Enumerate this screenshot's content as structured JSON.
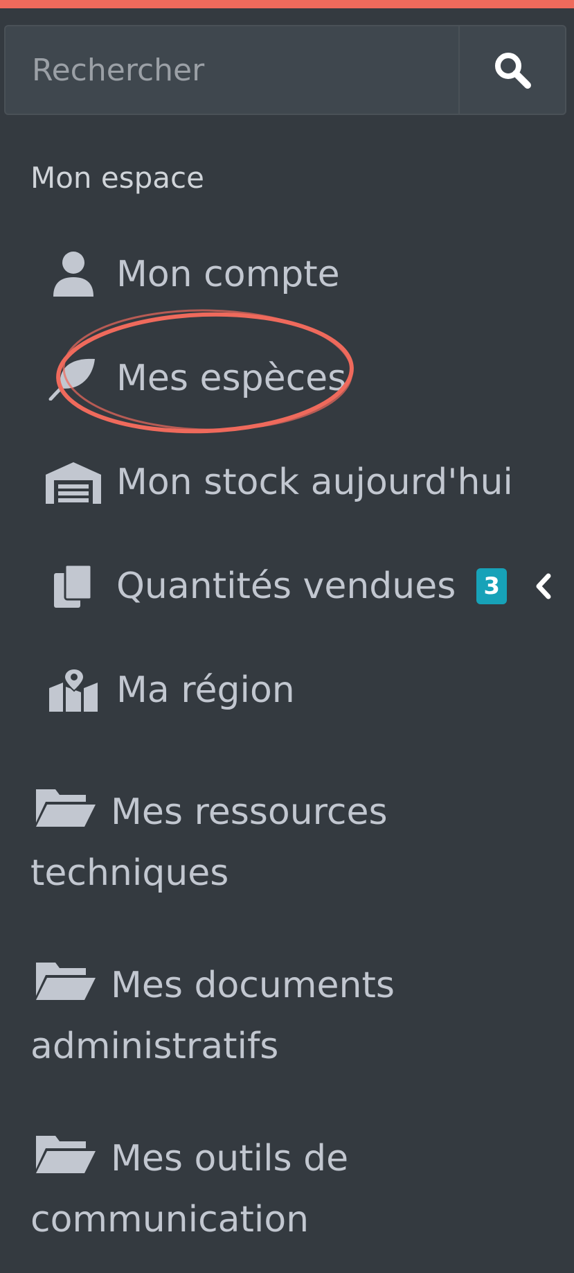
{
  "search": {
    "placeholder": "Rechercher",
    "button_icon": "search-icon"
  },
  "section": {
    "title": "Mon espace"
  },
  "nav": {
    "items": [
      {
        "label": "Mon compte",
        "icon": "user-icon"
      },
      {
        "label": "Mes espèces",
        "icon": "leaf-icon"
      },
      {
        "label": "Mon stock aujourd'hui",
        "icon": "warehouse-icon"
      },
      {
        "label": "Quantités vendues",
        "icon": "copy-icon",
        "badge": "3",
        "expand_icon": "chevron-left-icon"
      },
      {
        "label": "Ma région",
        "icon": "map-marked-icon"
      }
    ],
    "folders": [
      {
        "label": "Mes ressources techniques",
        "icon": "folder-open-icon"
      },
      {
        "label": "Mes documents administratifs",
        "icon": "folder-open-icon"
      },
      {
        "label": "Mes outils de communication",
        "icon": "folder-open-icon"
      }
    ]
  },
  "colors": {
    "background": "#343a40",
    "accent": "#ef6a5c",
    "text": "#c2c7d0",
    "badge": "#17a2b8"
  }
}
